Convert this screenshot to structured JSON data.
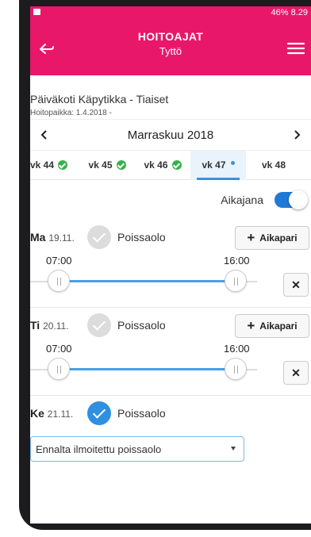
{
  "status_bar": {
    "right_text": "46% 8.29"
  },
  "header": {
    "title": "HOITOAJAT",
    "subtitle": "Tyttö"
  },
  "daycare": {
    "name": "Päiväkoti Käpytikka - Tiaiset",
    "placement": "Hoitopaikka: 1.4.2018 -"
  },
  "month_nav": {
    "month": "Marraskuu 2018"
  },
  "weeks": [
    {
      "label": "vk 44",
      "status": "done"
    },
    {
      "label": "vk 45",
      "status": "done"
    },
    {
      "label": "vk 46",
      "status": "done"
    },
    {
      "label": "vk 47",
      "status": "active"
    },
    {
      "label": "vk 48",
      "status": "none"
    }
  ],
  "timeline": {
    "label": "Aikajana",
    "enabled": true
  },
  "days": [
    {
      "weekday": "Ma",
      "date": "19.11.",
      "absent_label": "Poissaolo",
      "absent_checked": false,
      "add_label": "Aikapari",
      "start": "07:00",
      "end": "16:00"
    },
    {
      "weekday": "Ti",
      "date": "20.11.",
      "absent_label": "Poissaolo",
      "absent_checked": false,
      "add_label": "Aikapari",
      "start": "07:00",
      "end": "16:00"
    },
    {
      "weekday": "Ke",
      "date": "21.11.",
      "absent_label": "Poissaolo",
      "absent_checked": true,
      "absence_type": "Ennalta ilmoitettu poissaolo"
    }
  ],
  "colors": {
    "brand": "#e8176a",
    "accent": "#2f8fe0",
    "ok": "#35b24a"
  },
  "icons": {
    "back": "back-arrow-icon",
    "menu": "hamburger-menu-icon",
    "prev": "chevron-left-icon",
    "next": "chevron-right-icon",
    "remove": "close-icon"
  }
}
